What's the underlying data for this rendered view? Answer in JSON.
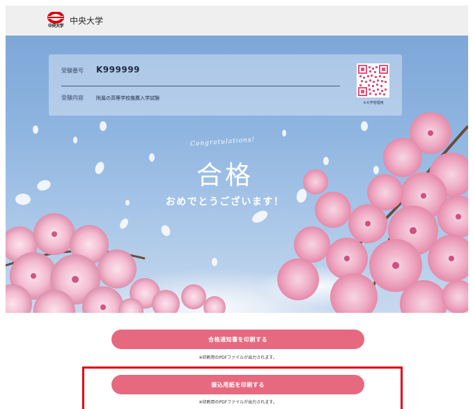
{
  "header": {
    "logo_small_text": "中央大学",
    "university_name": "中央大学"
  },
  "info": {
    "exam_number_label": "受験番号",
    "exam_number": "K999999",
    "exam_type_label": "受験内容",
    "exam_type": "附属の高等学校推薦入学試験",
    "qr_note": "※大学管理用"
  },
  "hero": {
    "congrats": "Congratulations!",
    "title": "合格",
    "message": "おめでとうございます！"
  },
  "actions": {
    "print_notice_label": "合格通知書を印刷する",
    "print_notice_note": "※印刷用のPDFファイルが出力されます。",
    "print_payment_label": "振込用紙を印刷する",
    "print_payment_note": "※印刷用のPDFファイルが出力されます。"
  },
  "colors": {
    "accent": "#e7697f",
    "highlight": "#e00010",
    "logo_red": "#d7000f"
  }
}
